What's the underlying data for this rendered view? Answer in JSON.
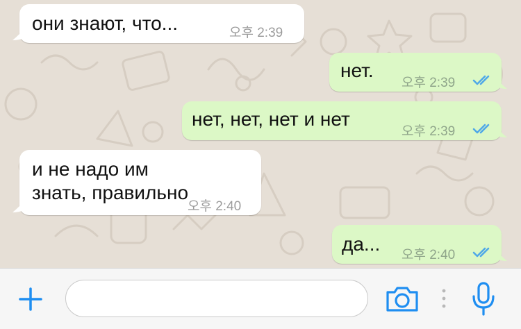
{
  "messages": [
    {
      "direction": "incoming",
      "text": "они знают, что...",
      "time": "오후 2:39"
    },
    {
      "direction": "outgoing",
      "text": "нет.",
      "time": "오후 2:39",
      "status": "read"
    },
    {
      "direction": "outgoing",
      "text": "нет, нет, нет и нет",
      "time": "오후 2:39",
      "status": "read"
    },
    {
      "direction": "incoming",
      "text_line1": "и не надо им",
      "text_line2": "знать, правильно",
      "time": "오후 2:40"
    },
    {
      "direction": "outgoing",
      "text": "да...",
      "time": "오후 2:40",
      "status": "read"
    }
  ],
  "composer": {
    "placeholder": "",
    "icons": {
      "add": "plus-icon",
      "camera": "camera-icon",
      "more": "more-dots-icon",
      "mic": "microphone-icon"
    }
  },
  "colors": {
    "incoming_bubble": "#ffffff",
    "outgoing_bubble": "#dcf8c6",
    "read_ticks": "#4fa8e8",
    "accent": "#1f8ef1",
    "wallpaper": "#e6dfd6"
  }
}
